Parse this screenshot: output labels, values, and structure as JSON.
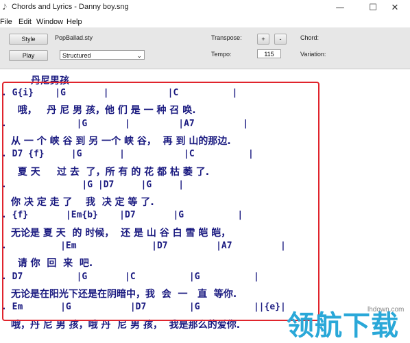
{
  "window": {
    "title": "Chords and Lyrics - Danny boy.sng",
    "app_icon": "music-note-icon",
    "minimize_glyph": "—",
    "maximize_glyph": "☐",
    "close_glyph": "✕"
  },
  "menu": [
    "File",
    "Edit",
    "Window",
    "Help"
  ],
  "toolbar": {
    "style_button": "Style",
    "style_file": "PopBallad.sty",
    "play_button": "Play",
    "mode_select": "Structured",
    "transpose_label": "Transpose:",
    "transpose_plus": "+",
    "transpose_minus": "-",
    "tempo_label": "Tempo:",
    "tempo_value": "115",
    "chord_label": "Chord:",
    "variation_label": "Variation:"
  },
  "song": {
    "title": "丹尼男孩",
    "lines": [
      {
        "type": "chord",
        "text": ". G{i}    |G       |           |C          |"
      },
      {
        "type": "lyric",
        "text": "  哦，   丹 尼 男 孩，他 们 是 一 种 召 唤."
      },
      {
        "type": "chord",
        "text": ".             |G       |         |A7         |"
      },
      {
        "type": "lyric",
        "text": "从 一 个 峡 谷 到 另 一个 峡 谷，  再 到 山的那边."
      },
      {
        "type": "chord",
        "text": ". D7 {f}     |G       |           |C          |"
      },
      {
        "type": "lyric",
        "text": "  夏 天     过 去  了，所 有 的 花 都 枯 萎 了."
      },
      {
        "type": "chord",
        "text": ".              |G |D7     |G     |"
      },
      {
        "type": "lyric",
        "text": "你 决 定 走 了    我  决 定 等 了."
      },
      {
        "type": "chord",
        "text": ". {f}       |Em{b}    |D7       |G          |"
      },
      {
        "type": "lyric",
        "text": "无论是 夏 天  的 时候，  还 是 山 谷 白 雪 皑 皑，"
      },
      {
        "type": "chord",
        "text": ".          |Em              |D7         |A7         |"
      },
      {
        "type": "lyric",
        "text": "  请 你  回  来  吧."
      },
      {
        "type": "chord",
        "text": ". D7          |G       |C          |G          |"
      },
      {
        "type": "lyric",
        "text": "无论是在阳光下还是在阴暗中，我  会  一   直  等你."
      },
      {
        "type": "chord",
        "text": ". Em       |G           |D7        |G          ||{e}|"
      },
      {
        "type": "lyric",
        "text": "哦，丹 尼 男 孩，哦 丹  尼 男 孩，  我是那么的爱你."
      }
    ]
  },
  "watermark": {
    "site": "lhdown.com",
    "text": "领航下载"
  },
  "colors": {
    "text": "#1a1a80",
    "highlight": "#e0242c",
    "toolbar_bg": "#e7e7e7"
  }
}
